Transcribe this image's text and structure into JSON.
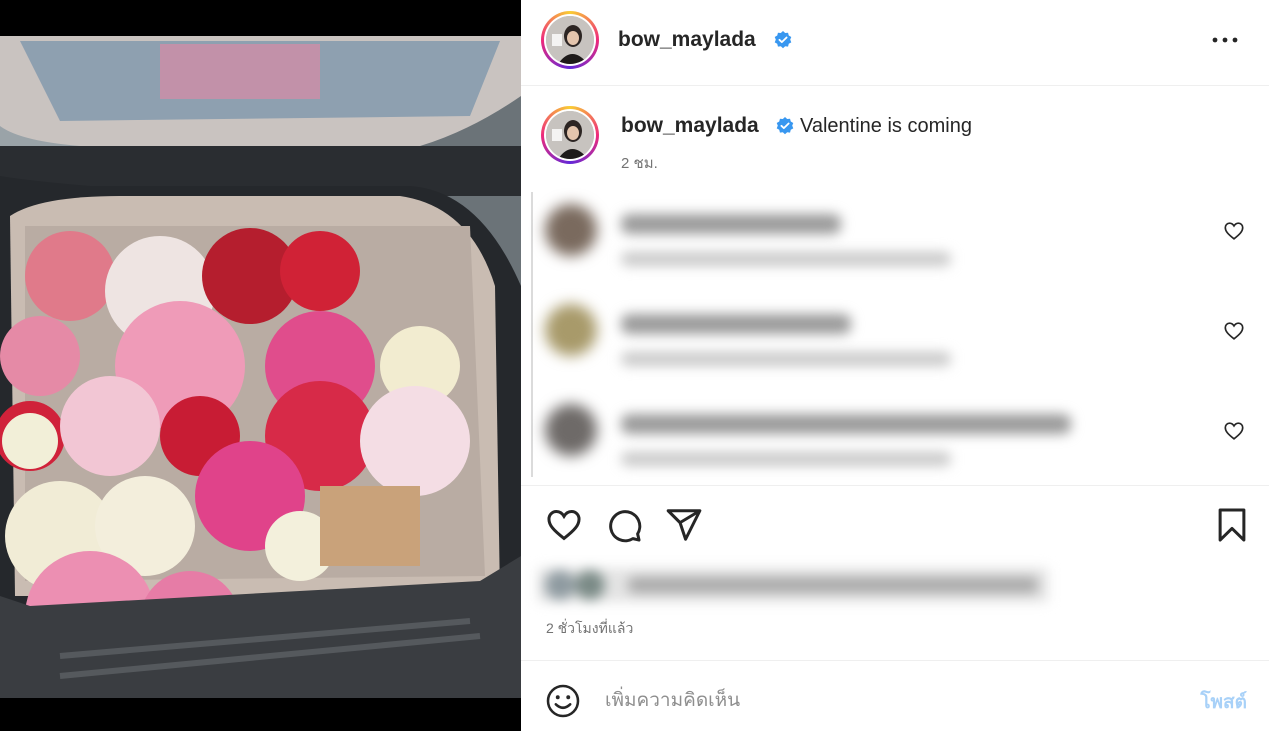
{
  "post": {
    "author": "bow_maylada",
    "verified": true,
    "caption": "Valentine is coming",
    "caption_time": "2 ชม.",
    "time_ago": "2 ชั่วโมงที่แล้ว"
  },
  "icons": {
    "more": "more-horizontal-icon",
    "verified": "verified-badge-icon",
    "like": "heart-icon",
    "comment": "comment-bubble-icon",
    "share": "paper-plane-icon",
    "save": "bookmark-icon",
    "emoji": "emoji-smile-icon"
  },
  "comments": [
    {
      "blurred": true
    },
    {
      "blurred": true
    },
    {
      "blurred": true
    }
  ],
  "comment_box": {
    "placeholder": "เพิ่มความคิดเห็น",
    "post_label": "โพสต์"
  },
  "colors": {
    "verified": "#3897f0",
    "post_button": "#a8d1f8",
    "muted_text": "#737373"
  }
}
